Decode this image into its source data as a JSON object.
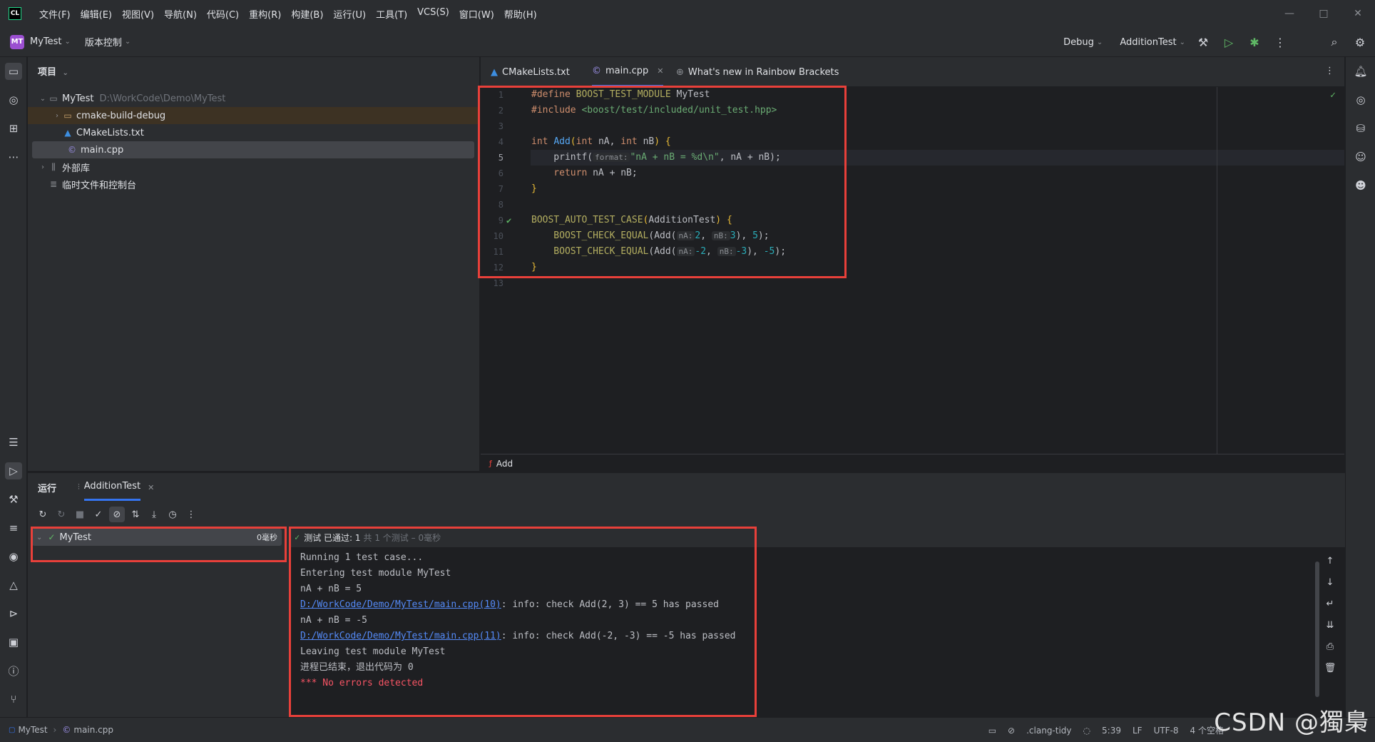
{
  "menubar": [
    "文件(F)",
    "编辑(E)",
    "视图(V)",
    "导航(N)",
    "代码(C)",
    "重构(R)",
    "构建(B)",
    "运行(U)",
    "工具(T)",
    "VCS(S)",
    "窗口(W)",
    "帮助(H)"
  ],
  "window_controls": [
    "—",
    "□",
    "✕"
  ],
  "toolbar": {
    "project_badge": "MT",
    "project_name": "MyTest",
    "vcs_label": "版本控制",
    "build_config": "Debug",
    "run_config": "AdditionTest"
  },
  "project_panel": {
    "header": "项目",
    "root_name": "MyTest",
    "root_path": "D:\\WorkCode\\Demo\\MyTest",
    "items": [
      {
        "label": "cmake-build-debug",
        "icon": "folder-icon"
      },
      {
        "label": "CMakeLists.txt",
        "icon": "cmake-icon"
      },
      {
        "label": "main.cpp",
        "icon": "cpp-file-icon"
      }
    ],
    "external_libs": "外部库",
    "scratches": "临时文件和控制台"
  },
  "editor_tabs": [
    {
      "label": "CMakeLists.txt",
      "icon": "cmake-icon"
    },
    {
      "label": "main.cpp",
      "icon": "cpp-file-icon",
      "active": true
    },
    {
      "label": "What's new in Rainbow Brackets",
      "icon": "globe-icon"
    }
  ],
  "code": {
    "line_numbers": [
      "1",
      "2",
      "3",
      "4",
      "5",
      "6",
      "7",
      "8",
      "9",
      "10",
      "11",
      "12",
      "13"
    ],
    "l1_a": "#define ",
    "l1_b": "BOOST_TEST_MODULE",
    " l1_c": " MyTest",
    "l1_c": " MyTest",
    "l2_a": "#include ",
    "l2_b": "<boost/test/included/unit_test.hpp>",
    "l4_a": "int ",
    "l4_b": "Add",
    "l4_c": "(",
    "l4_d": "int ",
    "l4_e": "nA, ",
    "l4_f": "int ",
    "l4_g": "nB",
    "l4_h": ") ",
    "l4_i": "{",
    "l5_a": "    printf(",
    "l5_hint": "format:",
    "l5_b": "\"nA + nB = %d\\n\"",
    "l5_c": ", nA + nB);",
    "l6_a": "    return ",
    "l6_b": "nA + nB;",
    "l7_a": "}",
    "l9_a": "BOOST_AUTO_TEST_CASE",
    "l9_b": "(",
    "l9_c": "AdditionTest",
    "l9_d": ") ",
    "l9_e": "{",
    "l10_a": "    BOOST_CHECK_EQUAL",
    "l10_b": "(Add(",
    "l10_h1": "nA:",
    "l10_c": "2",
    ", l10_d": ", ",
    "l10_d": ", ",
    "l10_h2": "nB:",
    "l10_e": "3",
    "l10_f": "), ",
    "l10_g": "5",
    "l10_i": ");",
    "l11_a": "    BOOST_CHECK_EQUAL",
    "l11_b": "(Add(",
    "l11_h1": "nA:",
    "l11_c": "-2",
    "l11_d": ", ",
    "l11_h2": "nB:",
    "l11_e": "-3",
    "l11_f": "), ",
    "l11_g": "-5",
    "l11_i": ");",
    "l12_a": "}"
  },
  "editor_breadcrumb": "Add",
  "run_panel": {
    "title": "运行",
    "tab_label": "AdditionTest",
    "test_root": "MyTest",
    "test_time": "0毫秒",
    "summary_passed": "测试 已通过: 1",
    "summary_detail": "共 1 个测试 – 0毫秒",
    "console": {
      "l1": "Running 1 test case...",
      "l2": "Entering test module MyTest",
      "l3": "nA + nB = 5",
      "l4_link": "D:/WorkCode/Demo/MyTest/main.cpp(10)",
      "l4_rest": ": info: check Add(2, 3) == 5 has passed",
      "l5": "nA + nB = -5",
      "l6_link": "D:/WorkCode/Demo/MyTest/main.cpp(11)",
      "l6_rest": ": info: check Add(-2, -3) == -5 has passed",
      "l7": "Leaving test module MyTest",
      "l8": "进程已结束，退出代码为 0",
      "l9": "*** No errors detected"
    }
  },
  "statusbar": {
    "crumb_project": "MyTest",
    "crumb_file": "main.cpp",
    "clang_tidy": ".clang-tidy",
    "position": "5:39",
    "line_ending": "LF",
    "encoding": "UTF-8",
    "indent": "4 个空格"
  },
  "watermark": "CSDN @獨梟",
  "colors": {
    "accent": "#3574f0",
    "highlight_box": "#e8403a",
    "pass_green": "#5fb865"
  }
}
